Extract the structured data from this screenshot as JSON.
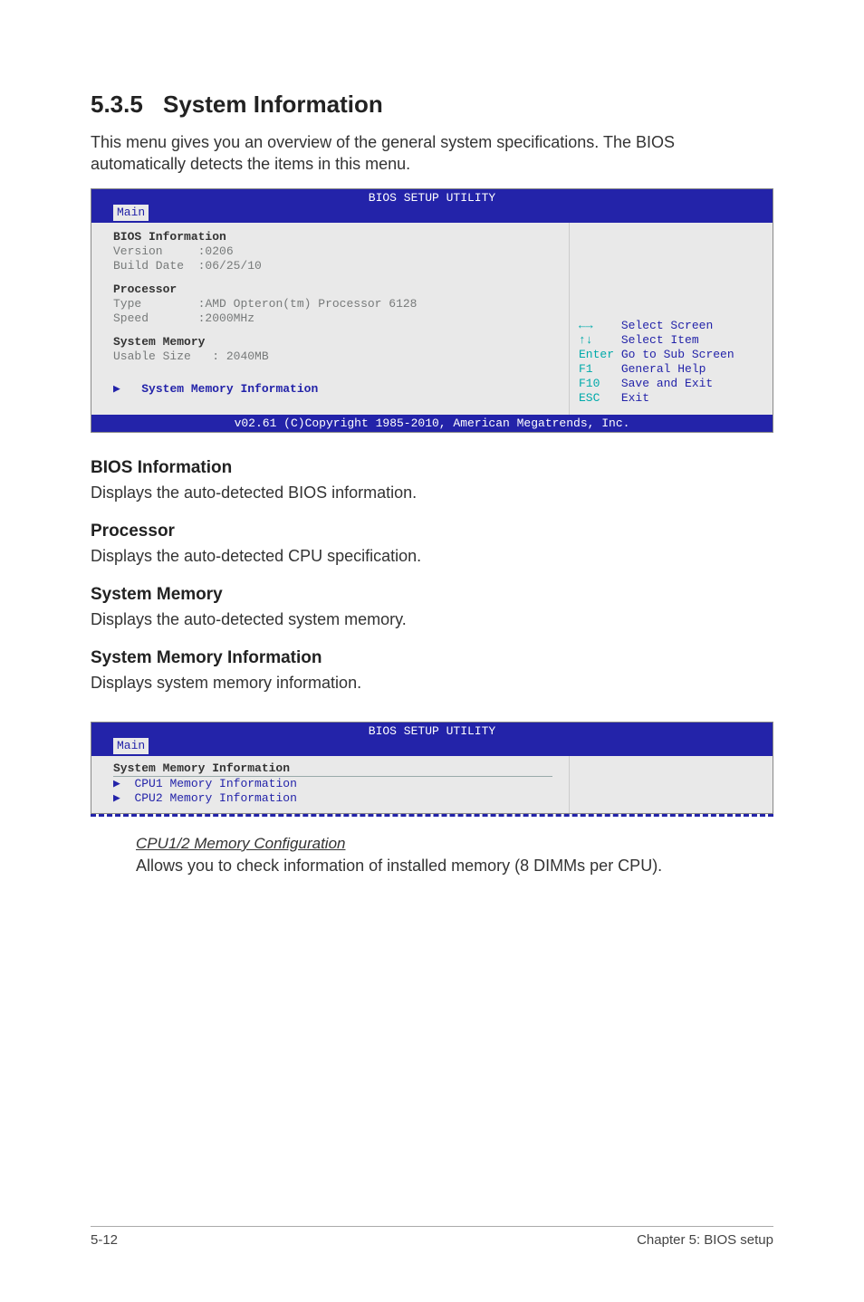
{
  "section": {
    "number": "5.3.5",
    "title": "System Information"
  },
  "intro": "This menu gives you an overview of the general system specifications. The BIOS automatically detects the items in this menu.",
  "bios1": {
    "utility_title": "BIOS SETUP UTILITY",
    "tab": "Main",
    "groups": {
      "bios_info": {
        "heading": "BIOS Information",
        "version_label": "Version",
        "version_value": ":0206",
        "build_label": "Build Date",
        "build_value": ":06/25/10"
      },
      "processor": {
        "heading": "Processor",
        "type_label": "Type",
        "type_value": ":AMD Opteron(tm) Processor 6128",
        "speed_label": "Speed",
        "speed_value": ":2000MHz"
      },
      "memory": {
        "heading": "System Memory",
        "usable_label": "Usable Size",
        "usable_value": ": 2040MB"
      },
      "submenu": "System Memory Information"
    },
    "help": {
      "l1_key": "←→",
      "l1_txt": "Select Screen",
      "l2_key": "↑↓",
      "l2_txt": "Select Item",
      "l3_key": "Enter",
      "l3_txt": "Go to Sub Screen",
      "l4_key": "F1",
      "l4_txt": "General Help",
      "l5_key": "F10",
      "l5_txt": "Save and Exit",
      "l6_key": "ESC",
      "l6_txt": "Exit"
    },
    "copyright": "v02.61 (C)Copyright 1985-2010, American Megatrends, Inc."
  },
  "subs": {
    "s1": {
      "h": "BIOS Information",
      "p": "Displays the auto-detected BIOS information."
    },
    "s2": {
      "h": "Processor",
      "p": "Displays the auto-detected CPU specification."
    },
    "s3": {
      "h": "System Memory",
      "p": "Displays the auto-detected system memory."
    },
    "s4": {
      "h": "System Memory Information",
      "p": "Displays system memory information."
    }
  },
  "bios2": {
    "utility_title": "BIOS SETUP UTILITY",
    "tab": "Main",
    "heading": "System Memory Information",
    "item1": "CPU1 Memory Information",
    "item2": "CPU2 Memory Information"
  },
  "cpu_config": {
    "title": "CPU1/2 Memory Configuration",
    "desc": "Allows you to check information of installed memory (8 DIMMs per CPU)."
  },
  "footer": {
    "left": "5-12",
    "right": "Chapter 5: BIOS setup"
  }
}
